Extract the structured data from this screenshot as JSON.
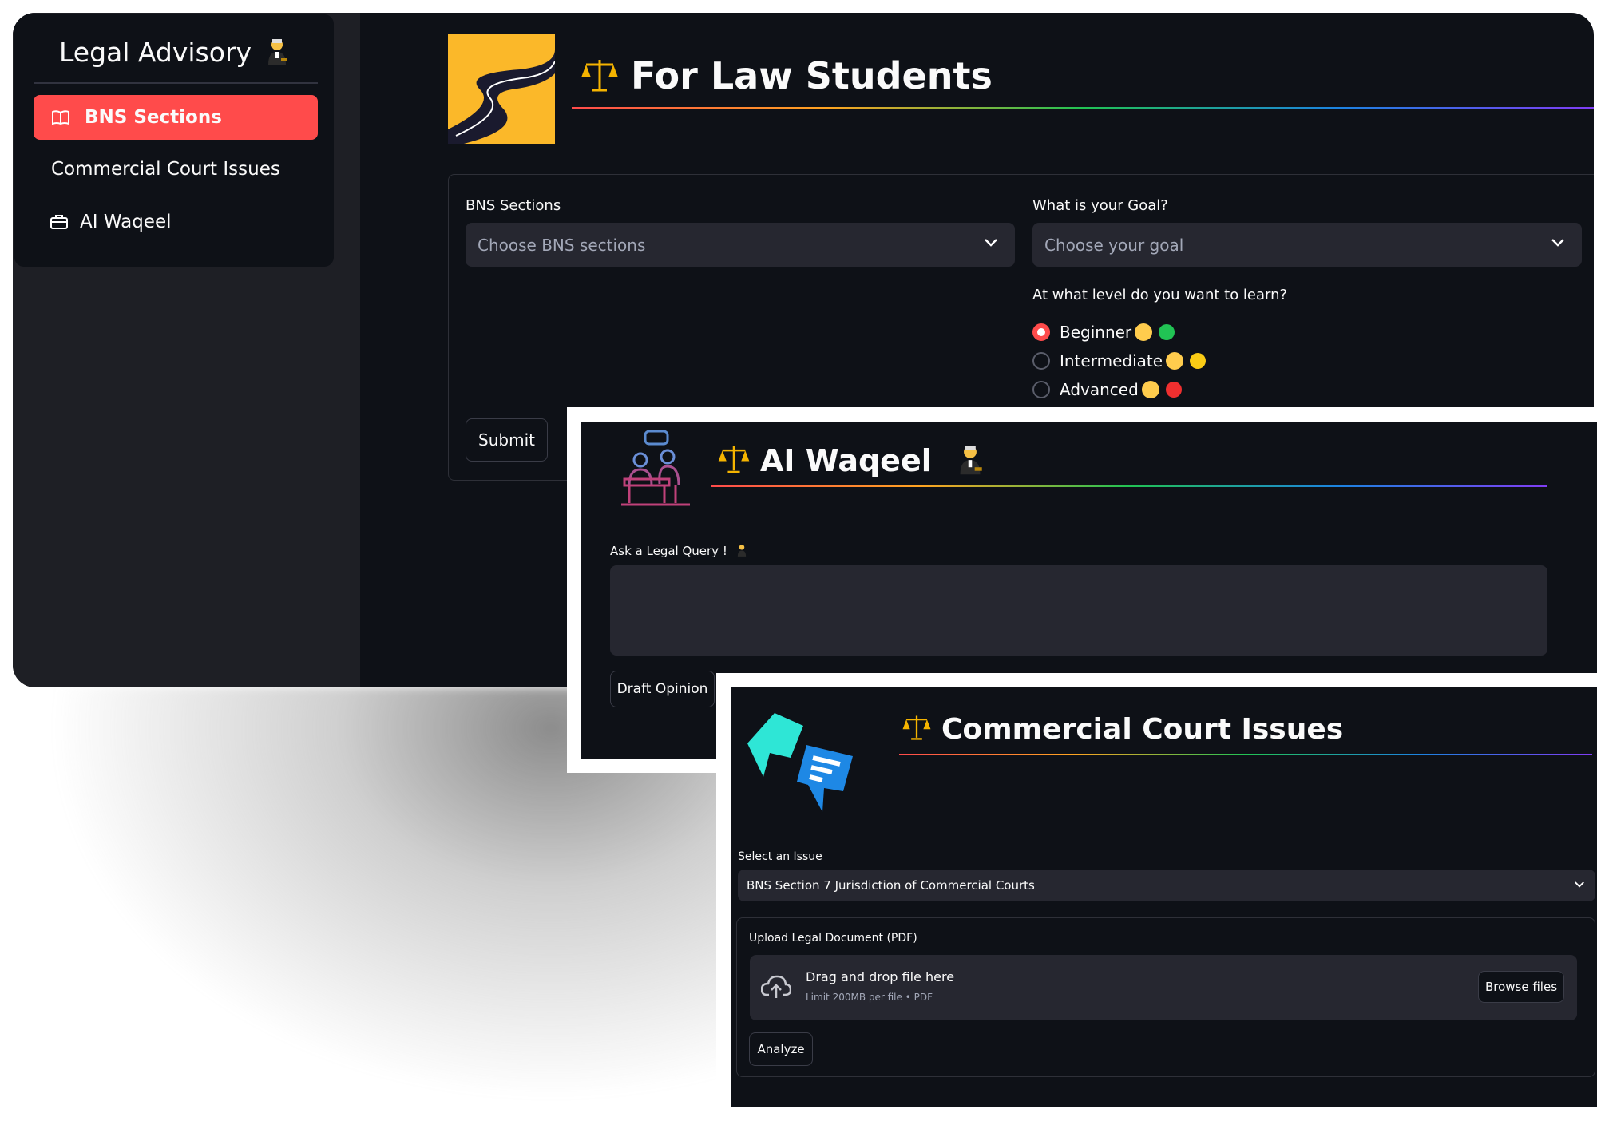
{
  "sidebar": {
    "brand": "Legal Advisory",
    "items": [
      {
        "label": "BNS Sections",
        "icon": "book-icon",
        "active": true
      },
      {
        "label": "Commercial Court Issues",
        "icon": "",
        "active": false
      },
      {
        "label": "AI Waqeel",
        "icon": "briefcase-icon",
        "active": false
      }
    ]
  },
  "law_students": {
    "title": "For Law Students",
    "bns_label": "BNS Sections",
    "bns_placeholder": "Choose BNS sections",
    "goal_label": "What is your Goal?",
    "goal_placeholder": "Choose your goal",
    "level_label": "At what level do you want to learn?",
    "levels": [
      {
        "label": "Beginner",
        "selected": true,
        "color": "#21c354"
      },
      {
        "label": "Intermediate",
        "selected": false,
        "color": "#facc15"
      },
      {
        "label": "Advanced",
        "selected": false,
        "color": "#ef2f2f"
      }
    ],
    "submit_label": "Submit"
  },
  "ai_waqeel": {
    "title": "AI Waqeel",
    "query_label": "Ask a Legal Query !",
    "query_value": "",
    "draft_label": "Draft Opinion"
  },
  "commercial": {
    "title": "Commercial Court Issues",
    "issue_label": "Select an Issue",
    "issue_value": "BNS Section 7 Jurisdiction of Commercial Courts",
    "upload_label": "Upload Legal Document (PDF)",
    "drop_text": "Drag and drop file here",
    "drop_hint": "Limit 200MB per file • PDF",
    "browse_label": "Browse files",
    "analyze_label": "Analyze"
  },
  "colors": {
    "accent": "#ff4b4b",
    "background": "#0e1117",
    "widget": "#262730",
    "sidebar": "#1e1f25"
  }
}
